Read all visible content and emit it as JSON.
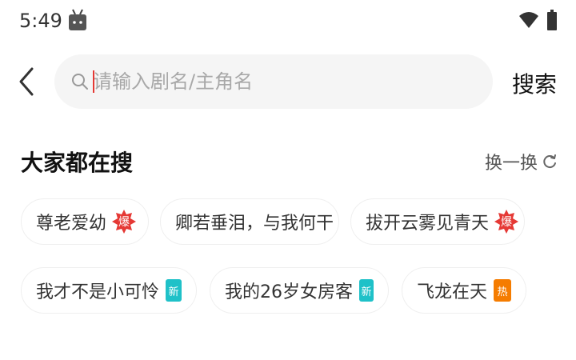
{
  "status_bar": {
    "time": "5:49"
  },
  "search": {
    "placeholder": "请输入剧名/主角名",
    "value": "",
    "button_label": "搜索"
  },
  "hot_section": {
    "title": "大家都在搜",
    "refresh_label": "换一换"
  },
  "badges": {
    "hot": "爆",
    "new": "新",
    "trending": "热"
  },
  "tags": [
    {
      "label": "尊老爱幼",
      "badge": "爆"
    },
    {
      "label": "卿若垂泪，与我何干",
      "badge": ""
    },
    {
      "label": "拔开云雾见青天",
      "badge": "爆"
    },
    {
      "label": "我才不是小可怜",
      "badge": "新"
    },
    {
      "label": "我的26岁女房客",
      "badge": "新"
    },
    {
      "label": "飞龙在天",
      "badge": "热"
    }
  ],
  "colors": {
    "accent_red": "#e53935",
    "badge_hot": "#e53935",
    "badge_new": "#1fc1c8",
    "badge_trending": "#f57c00"
  }
}
